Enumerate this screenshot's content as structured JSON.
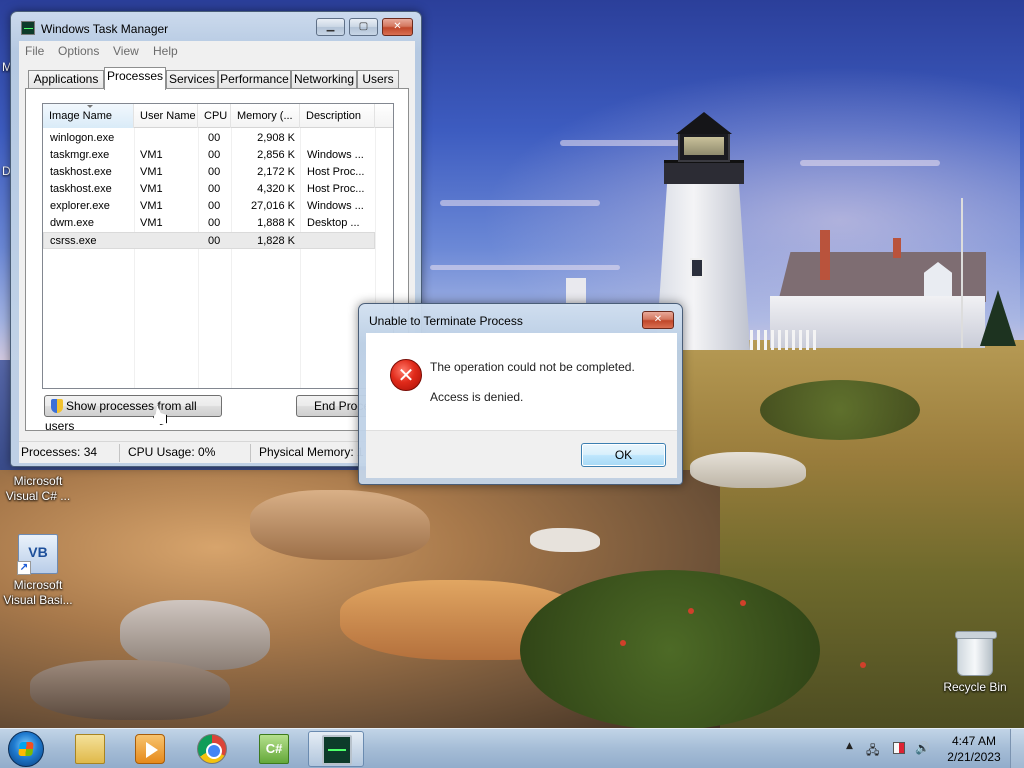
{
  "desktop": {
    "icons": [
      {
        "label_line1": "Microsoft",
        "label_line2": "Visual C# ...",
        "icon": "visual-csharp-icon"
      },
      {
        "label_line1": "Microsoft",
        "label_line2": "Visual Basi...",
        "icon": "visual-basic-icon",
        "badge": "VB"
      },
      {
        "label": "Recycle Bin",
        "icon": "recycle-bin-icon"
      }
    ],
    "edge_letters": [
      "M",
      "D"
    ]
  },
  "task_manager": {
    "title": "Windows Task Manager",
    "menu": [
      "File",
      "Options",
      "View",
      "Help"
    ],
    "tabs": [
      "Applications",
      "Processes",
      "Services",
      "Performance",
      "Networking",
      "Users"
    ],
    "active_tab": "Processes",
    "columns": [
      "Image Name",
      "User Name",
      "CPU",
      "Memory (...",
      "Description"
    ],
    "processes": [
      {
        "image": "winlogon.exe",
        "user": "",
        "cpu": "00",
        "memory": "2,908 K",
        "description": ""
      },
      {
        "image": "taskmgr.exe",
        "user": "VM1",
        "cpu": "00",
        "memory": "2,856 K",
        "description": "Windows ..."
      },
      {
        "image": "taskhost.exe",
        "user": "VM1",
        "cpu": "00",
        "memory": "2,172 K",
        "description": "Host Proc..."
      },
      {
        "image": "taskhost.exe",
        "user": "VM1",
        "cpu": "00",
        "memory": "4,320 K",
        "description": "Host Proc..."
      },
      {
        "image": "explorer.exe",
        "user": "VM1",
        "cpu": "00",
        "memory": "27,016 K",
        "description": "Windows ..."
      },
      {
        "image": "dwm.exe",
        "user": "VM1",
        "cpu": "00",
        "memory": "1,888 K",
        "description": "Desktop ..."
      },
      {
        "image": "csrss.exe",
        "user": "",
        "cpu": "00",
        "memory": "1,828 K",
        "description": ""
      }
    ],
    "selected_row": 6,
    "show_all_button": "Show processes from all users",
    "end_process_button": "End Proce",
    "status": {
      "processes": "Processes: 34",
      "cpu": "CPU Usage: 0%",
      "memory": "Physical Memory: 1"
    }
  },
  "dialog": {
    "title": "Unable to Terminate Process",
    "message": "The operation could not be completed.",
    "detail": "Access is denied.",
    "ok_label": "OK",
    "icon": "error-icon"
  },
  "taskbar": {
    "pinned": [
      {
        "name": "windows-explorer",
        "icon": "folder-icon"
      },
      {
        "name": "media-player",
        "icon": "media-player-icon"
      },
      {
        "name": "chrome",
        "icon": "chrome-icon"
      },
      {
        "name": "visual-csharp",
        "icon": "csharp-icon",
        "text": "C#"
      },
      {
        "name": "task-manager",
        "icon": "task-manager-icon",
        "active": true
      }
    ],
    "clock_time": "4:47 AM",
    "clock_date": "2/21/2023"
  }
}
